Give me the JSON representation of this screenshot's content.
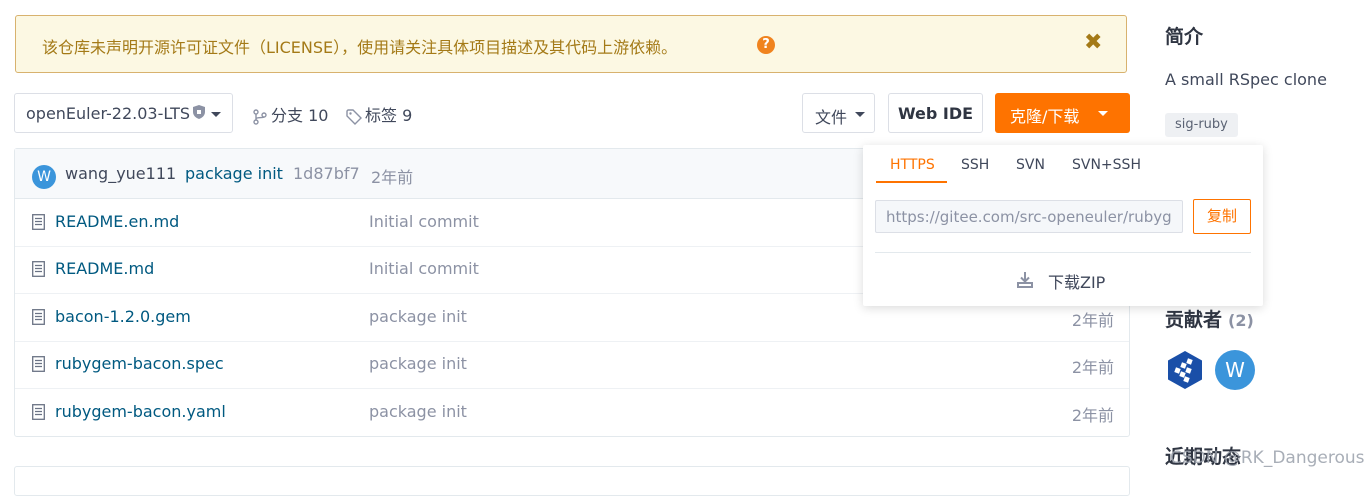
{
  "banner": {
    "text": "该仓库未声明开源许可证文件（LICENSE），使用请关注具体项目描述及其代码上游依赖。",
    "help_glyph": "?",
    "close_glyph": "✖"
  },
  "toolbar": {
    "branch": "openEuler-22.03-LTS",
    "branches_label": "分支 10",
    "tags_label": "标签 9",
    "files_label": "文件",
    "webide_label": "Web IDE",
    "clone_label": "克隆/下载"
  },
  "commit": {
    "avatar_initial": "W",
    "author": "wang_yue111",
    "message": "package init",
    "hash": "1d87bf7",
    "time": "2年前"
  },
  "files": [
    {
      "name": "README.en.md",
      "commit": "Initial commit",
      "time": ""
    },
    {
      "name": "README.md",
      "commit": "Initial commit",
      "time": ""
    },
    {
      "name": "bacon-1.2.0.gem",
      "commit": "package init",
      "time": "2年前"
    },
    {
      "name": "rubygem-bacon.spec",
      "commit": "package init",
      "time": "2年前"
    },
    {
      "name": "rubygem-bacon.yaml",
      "commit": "package init",
      "time": "2年前"
    }
  ],
  "clone_panel": {
    "tabs": [
      "HTTPS",
      "SSH",
      "SVN",
      "SVN+SSH"
    ],
    "active_tab": "HTTPS",
    "url": "https://gitee.com/src-openeuler/rubygem-bacon.git",
    "copy_label": "复制",
    "zip_label": "下载ZIP"
  },
  "sidebar": {
    "intro_title": "简介",
    "description": "A small RSpec clone",
    "tag": "sig-ruby",
    "contributors_title": "贡献者",
    "contributors_count": "(2)",
    "contributor2_initial": "W",
    "recent_title": "近期动态"
  },
  "watermark": "CSDN @RK_Dangerous",
  "colors": {
    "accent": "#fe7300",
    "banner_bg": "#fcf8e3",
    "banner_text": "#a47a17",
    "link": "#005980"
  }
}
